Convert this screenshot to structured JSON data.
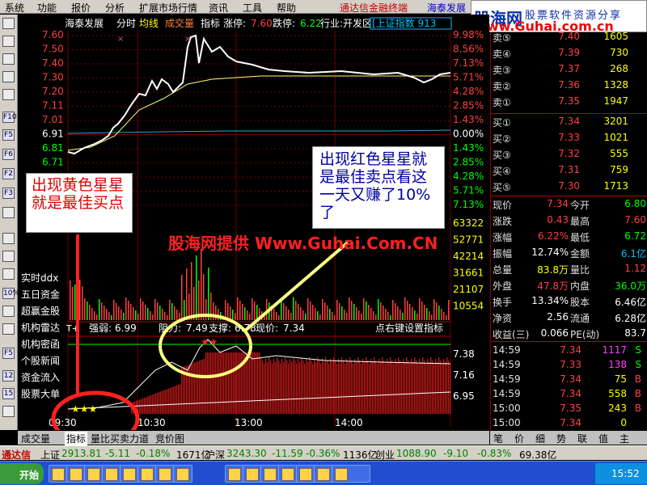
{
  "colors": {
    "up": "#ff4040",
    "down": "#00ff00",
    "yellow": "#ffff00",
    "cyan": "#00c0ff",
    "white": "#ffffff",
    "grid": "#800000"
  },
  "menu": [
    "系统",
    "功能",
    "报价",
    "分析",
    "扩展市场行情",
    "资讯",
    "工具",
    "帮助"
  ],
  "promo1": "通达信金融终端",
  "promo2": "海泰发展",
  "logo": {
    "big": "股海网",
    "tag": "股票软件资源分享",
    "url": "www.Guhai.com.cn"
  },
  "chart_header": {
    "name": "海泰发展",
    "period": "分时",
    "avg": "均线",
    "vol": "成交量",
    "ind": "指标",
    "limit_up_label": "涨停:",
    "limit_up": "7.60",
    "limit_down_label": "跌停:",
    "limit_down": "6.22",
    "industry": "行业:开发区",
    "market": "[上证指数 913"
  },
  "price_labels": [
    "7.60",
    "7.50",
    "7.40",
    "7.30",
    "7.20",
    "7.11",
    "7.01",
    "6.91",
    "6.81",
    "6.71"
  ],
  "pct_labels": [
    "9.98%",
    "8.56%",
    "7.13%",
    "5.71%",
    "4.28%",
    "2.85%",
    "1.43%",
    "0.00%",
    "1.43%",
    "2.85%",
    "4.28%",
    "5.71%",
    "7.13%"
  ],
  "vol_labels": [
    "63322",
    "52771",
    "42214",
    "31661",
    "21107",
    "10554"
  ],
  "ddx_labels": [
    "实时ddx",
    "五日资金",
    "超赢金股",
    "机构雷达",
    "机构密函",
    "个股新闻",
    "资金流入",
    "股票大单"
  ],
  "ind_header": {
    "mode": "T+",
    "weak_label": "强弱:",
    "weak": "6.99",
    "res_label": "阻力:",
    "res": "7.49",
    "sup_label": "支撑:",
    "sup": "6.78",
    "cur_label": "现价:",
    "cur": "7.34",
    "hint": "点右键设置指标"
  },
  "ind_labels": [
    "7.38",
    "7.16",
    "6.95"
  ],
  "time_labels": [
    "09:30",
    "10:30",
    "13:00",
    "14:00"
  ],
  "watermark": "股海网提供 Www.Guhai.Com.CN",
  "anno_yellow": "出现黄色星星就是最佳买点",
  "anno_red": "出现红色星星就是最佳卖点看这一天又赚了10%了",
  "sells": [
    {
      "l": "卖⑤",
      "p": "7.40",
      "v": "1605"
    },
    {
      "l": "卖④",
      "p": "7.39",
      "v": "730"
    },
    {
      "l": "卖③",
      "p": "7.37",
      "v": "268"
    },
    {
      "l": "卖②",
      "p": "7.36",
      "v": "1328"
    },
    {
      "l": "卖①",
      "p": "7.35",
      "v": "1947"
    }
  ],
  "buys": [
    {
      "l": "买①",
      "p": "7.34",
      "v": "3201"
    },
    {
      "l": "买②",
      "p": "7.33",
      "v": "1021"
    },
    {
      "l": "买③",
      "p": "7.32",
      "v": "555"
    },
    {
      "l": "买④",
      "p": "7.31",
      "v": "759"
    },
    {
      "l": "买⑤",
      "p": "7.30",
      "v": "1713"
    }
  ],
  "quotes": [
    {
      "l1": "现价",
      "v1": "7.34",
      "l2": "今开",
      "v2": "6.80"
    },
    {
      "l1": "涨跌",
      "v1": "0.43",
      "l2": "最高",
      "v2": "7.60"
    },
    {
      "l1": "涨幅",
      "v1": "6.22%",
      "l2": "最低",
      "v2": "6.72"
    },
    {
      "l1": "振幅",
      "v1": "12.74%",
      "l2": "金额",
      "v2": "6.1亿"
    },
    {
      "l1": "总量",
      "v1": "83.8万",
      "l2": "量比",
      "v2": "1.12"
    },
    {
      "l1": "外盘",
      "v1": "47.8万",
      "l2": "内盘",
      "v2": "36.0万"
    },
    {
      "l1": "换手",
      "v1": "13.34%",
      "l2": "股本",
      "v2": "6.46亿"
    },
    {
      "l1": "净资",
      "v1": "2.56",
      "l2": "流通",
      "v2": "6.28亿"
    },
    {
      "l1": "收益(三)",
      "v1": "0.066",
      "l2": "PE(动)",
      "v2": "83.7"
    }
  ],
  "ticks": [
    {
      "t": "14:59",
      "p": "7.34",
      "v": "1117",
      "s": "S"
    },
    {
      "t": "14:59",
      "p": "7.33",
      "v": "138",
      "s": "S"
    },
    {
      "t": "14:59",
      "p": "7.34",
      "v": "75",
      "s": "B"
    },
    {
      "t": "14:59",
      "p": "7.34",
      "v": "558",
      "s": "B"
    },
    {
      "t": "15:00",
      "p": "7.35",
      "v": "243",
      "s": "B"
    },
    {
      "t": "15:00",
      "p": "7.34",
      "v": "0",
      "s": ""
    }
  ],
  "bottom_tabs": [
    "成交量",
    "指标",
    "量比",
    "买卖力道",
    "竞价图"
  ],
  "right_tabs": [
    "笔",
    "价",
    "细",
    "势",
    "联",
    "值",
    "主"
  ],
  "status": {
    "brand": "通达信",
    "sh_label": "上证",
    "sh": "2913.81",
    "sh_chg": "-5.11",
    "sh_pct": "-0.18%",
    "sh_amt": "1671亿",
    "sz_label": "沪深",
    "sz": "3243.30",
    "sz_chg": "-11.59",
    "sz_pct": "-0.36%",
    "sz_amt": "1136亿",
    "cy_label": "创业",
    "cy": "1088.90",
    "cy_chg": "-9.10",
    "cy_pct": "-0.83%",
    "cy_amt": "69.38亿"
  },
  "taskbar": {
    "start": "开始",
    "items": [
      "",
      "I",
      "3",
      "",
      "",
      "",
      "",
      "",
      "",
      "D",
      "",
      "",
      "",
      "",
      ""
    ],
    "clock": "15:52"
  }
}
